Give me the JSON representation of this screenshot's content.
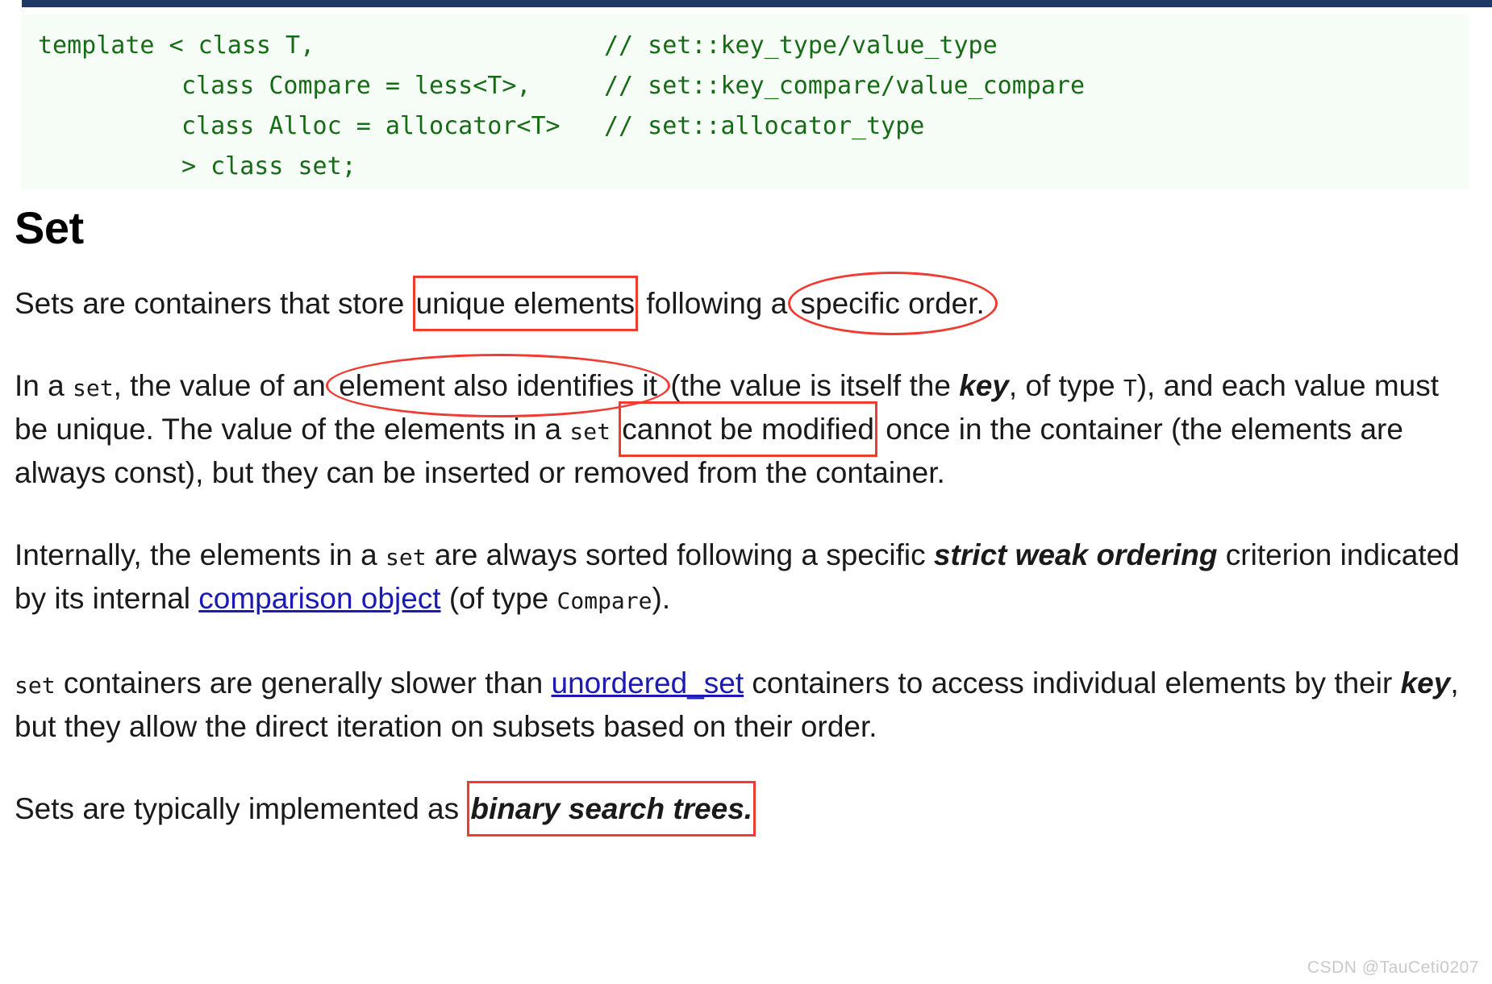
{
  "code_block": {
    "language": "cpp",
    "background": "#f6fdf6",
    "text_color": "#176b17",
    "lines": [
      {
        "indent": 0,
        "code": "template < class T,",
        "comment": "// set::key_type/value_type"
      },
      {
        "indent": 1,
        "code": "class Compare = less<T>,",
        "comment": "// set::key_compare/value_compare"
      },
      {
        "indent": 1,
        "code": "class Alloc = allocator<T>",
        "comment": "// set::allocator_type"
      },
      {
        "indent": 1,
        "code": "> class set;",
        "comment": ""
      }
    ]
  },
  "top_bar": {
    "color": "#1f3864"
  },
  "article": {
    "title": "Set",
    "paragraphs": [
      {
        "id": "p1",
        "segments": [
          {
            "type": "text",
            "text": "Sets are containers that store "
          },
          {
            "type": "box",
            "text": "unique elements"
          },
          {
            "type": "text",
            "text": " following a "
          },
          {
            "type": "ellipse",
            "text": "specific order."
          }
        ]
      },
      {
        "id": "p2",
        "segments": [
          {
            "type": "text",
            "text": "In a "
          },
          {
            "type": "code",
            "text": "set"
          },
          {
            "type": "text",
            "text": ", the value of an "
          },
          {
            "type": "ellipse",
            "text": "element also identifies it"
          },
          {
            "type": "text",
            "text": " (the value is itself the "
          },
          {
            "type": "bold",
            "text": "key"
          },
          {
            "type": "text",
            "text": ", of type "
          },
          {
            "type": "code",
            "text": "T"
          },
          {
            "type": "text",
            "text": "), and each value must be unique. The value of the elements in a "
          },
          {
            "type": "code",
            "text": "set"
          },
          {
            "type": "text",
            "text": " "
          },
          {
            "type": "box",
            "text": "cannot be modified"
          },
          {
            "type": "text",
            "text": " once in the container (the elements are always const), but they can be inserted or removed from the container."
          }
        ]
      },
      {
        "id": "p3",
        "segments": [
          {
            "type": "text",
            "text": "Internally, the elements in a "
          },
          {
            "type": "code",
            "text": "set"
          },
          {
            "type": "text",
            "text": " are always sorted following a specific "
          },
          {
            "type": "bold",
            "text": "strict weak ordering"
          },
          {
            "type": "text",
            "text": " criterion indicated by its internal "
          },
          {
            "type": "link",
            "text": "comparison object"
          },
          {
            "type": "text",
            "text": " (of type "
          },
          {
            "type": "code",
            "text": "Compare"
          },
          {
            "type": "text",
            "text": ")."
          }
        ]
      },
      {
        "id": "p4",
        "segments": [
          {
            "type": "code",
            "text": "set"
          },
          {
            "type": "text",
            "text": " containers are generally slower than "
          },
          {
            "type": "link",
            "text": "unordered_set"
          },
          {
            "type": "text",
            "text": " containers to access individual elements by their "
          },
          {
            "type": "bold",
            "text": "key"
          },
          {
            "type": "text",
            "text": ", but they allow the direct iteration on subsets based on their order."
          }
        ]
      },
      {
        "id": "p5",
        "segments": [
          {
            "type": "text",
            "text": "Sets are typically implemented as "
          },
          {
            "type": "box_bold",
            "text": "binary search trees."
          }
        ]
      }
    ],
    "link_color": "#1b1bb3",
    "annotation_color": "#f03b32"
  },
  "watermark": {
    "text": "CSDN @TauCeti0207"
  }
}
